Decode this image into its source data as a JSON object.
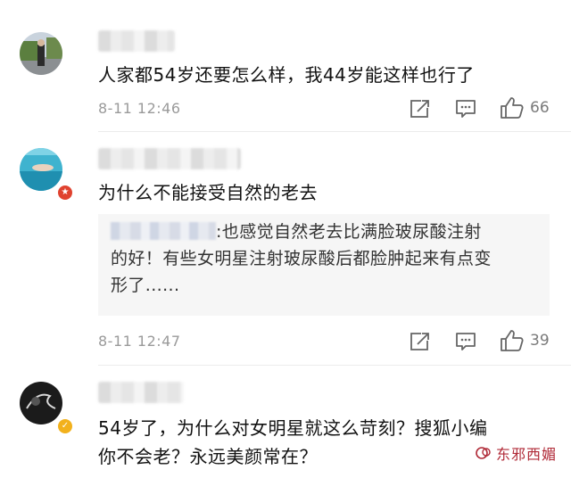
{
  "comments": [
    {
      "text": "人家都54岁还要怎么样，我44岁能这样也行了",
      "time": "8-11 12:46",
      "likes": "66"
    },
    {
      "text": "为什么不能接受自然的老去",
      "time": "8-11 12:47",
      "likes": "39",
      "reply": {
        "text_line1": ":也感觉自然老去比满脸玻尿酸注射",
        "text_line2": "的好！有些女明星注射玻尿酸后都脸肿起来有点变",
        "text_line3": "形了......"
      }
    },
    {
      "text_line1": "54岁了，为什么对女明星就这么苛刻？搜狐小编",
      "text_line2": "你不会老？永远美颜常在？"
    }
  ],
  "watermark": "东邪西媚",
  "icons": [
    "share-icon",
    "comment-icon",
    "like-icon"
  ],
  "colors": {
    "accent_red": "#b02a37",
    "verified_gold": "#f2b11c",
    "badge_red": "#e0422f"
  }
}
